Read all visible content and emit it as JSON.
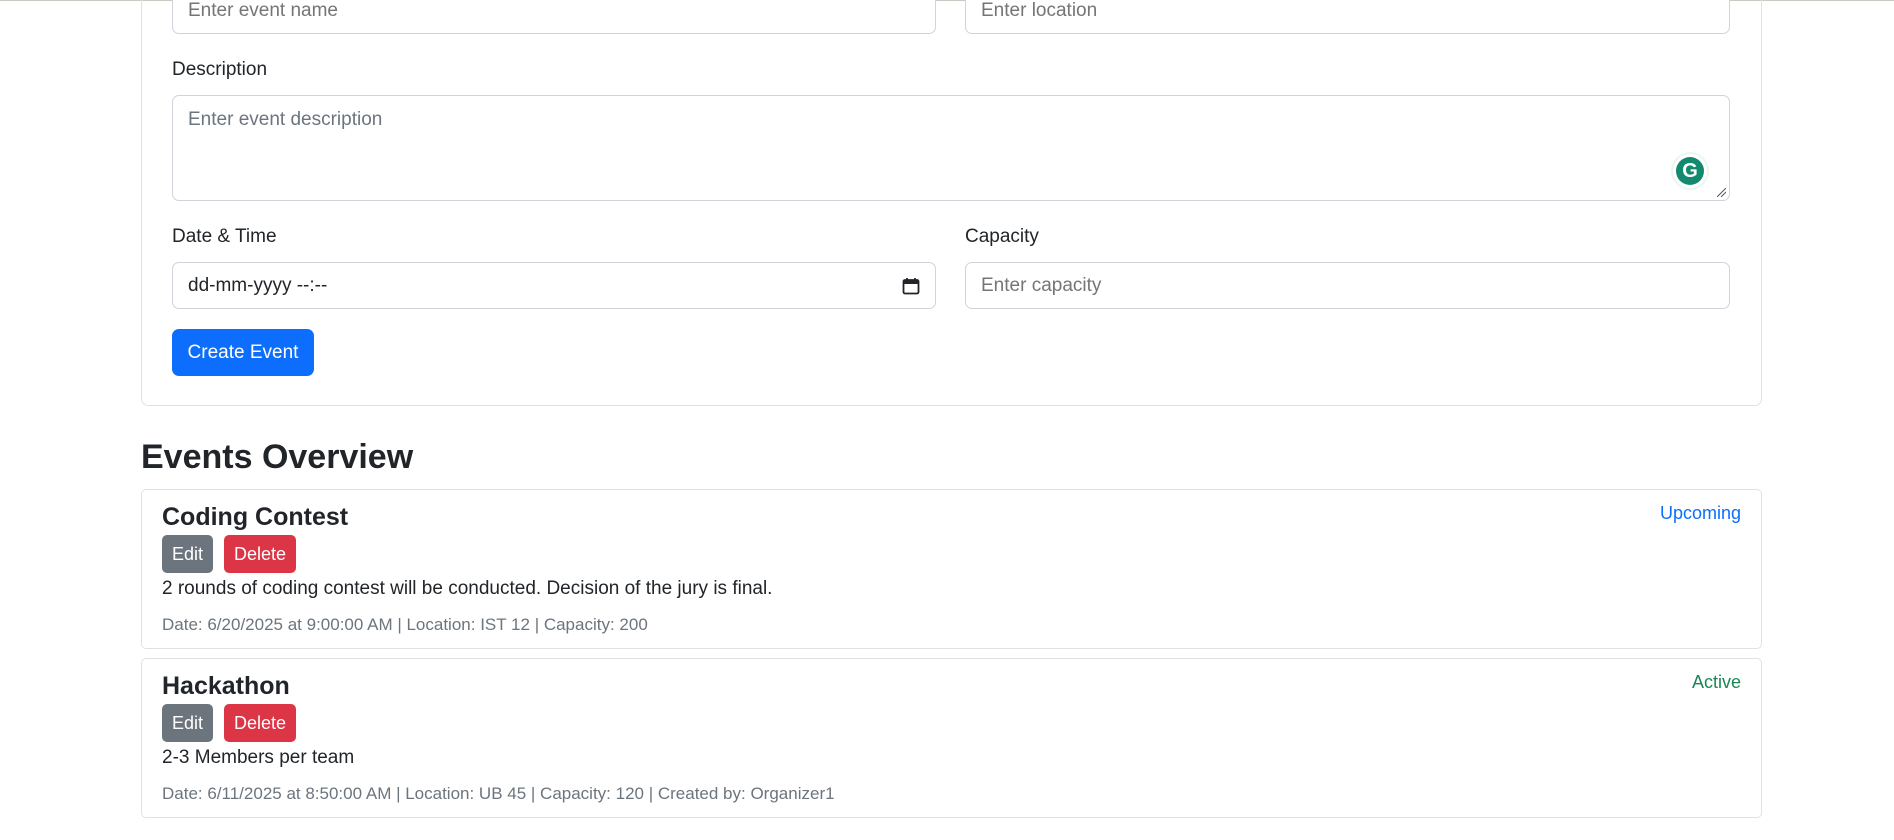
{
  "form": {
    "name_placeholder": "Enter event name",
    "location_placeholder": "Enter location",
    "description_label": "Description",
    "description_placeholder": "Enter event description",
    "datetime_label": "Date & Time",
    "datetime_value": "dd-mm-yyyy --:--",
    "capacity_label": "Capacity",
    "capacity_placeholder": "Enter capacity",
    "create_button": "Create Event"
  },
  "overview": {
    "title": "Events Overview",
    "events": [
      {
        "name": "Coding Contest",
        "status": "Upcoming",
        "edit_label": "Edit",
        "delete_label": "Delete",
        "description": "2 rounds of coding contest will be conducted. Decision of the jury is final.",
        "meta": "Date: 6/20/2025 at 9:00:00 AM | Location: IST 12 | Capacity: 200"
      },
      {
        "name": "Hackathon",
        "status": "Active",
        "edit_label": "Edit",
        "delete_label": "Delete",
        "description": "2-3 Members per team",
        "meta": "Date: 6/11/2025 at 8:50:00 AM | Location: UB 45 | Capacity: 120 | Created by: Organizer1"
      }
    ]
  },
  "colors": {
    "primary": "#0d6efd",
    "secondary": "#6c757d",
    "danger": "#dc3545",
    "success": "#198754",
    "grammarly": "#13896f"
  },
  "icons": {
    "calendar": "calendar-icon",
    "grammarly": "grammarly-icon"
  }
}
